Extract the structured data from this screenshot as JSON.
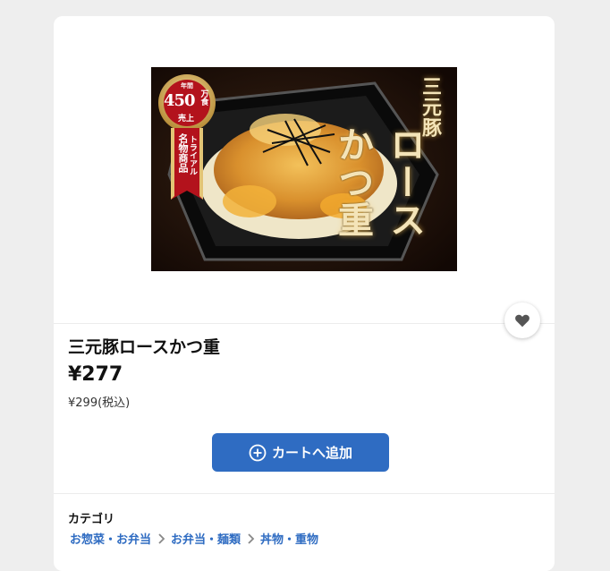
{
  "product": {
    "image": {
      "vertical_small": "三元豚",
      "vertical_big": "ロースかつ重",
      "badge_top": "年間",
      "badge_number": "450",
      "badge_unit": "万食",
      "badge_sold": "売上",
      "ribbon_line1": "トライアル",
      "ribbon_line2": "名物商品"
    },
    "title": "三元豚ロースかつ重",
    "price": "¥277",
    "price_with_tax": "¥299(税込)"
  },
  "cart_button": {
    "label": "カートへ追加"
  },
  "category": {
    "label": "カテゴリ",
    "breadcrumbs": [
      "お惣菜・お弁当",
      "お弁当・麺類",
      "丼物・重物"
    ]
  },
  "colors": {
    "accent": "#2f6cc2",
    "background": "#eeeeee"
  },
  "icons": {
    "favorite": "heart-icon",
    "add": "plus-circle-icon",
    "separator": "chevron-right-icon"
  }
}
